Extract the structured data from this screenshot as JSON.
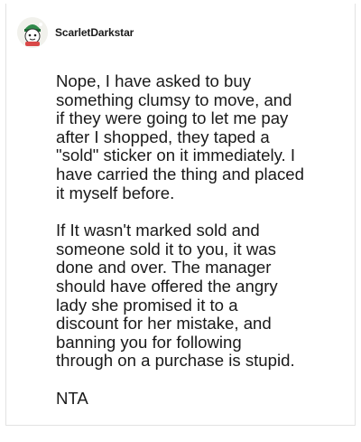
{
  "comment": {
    "username": "ScarletDarkstar",
    "avatar_icon": "avatar-icon",
    "paragraphs": [
      "Nope, I have asked to buy\nsomething clumsy to move, and\nif they were going to let me pay\nafter I shopped, they taped a\n\"sold\" sticker on it immediately. I\nhave carried the thing and placed\nit myself before.",
      "If It wasn't marked sold and\nsomeone sold it to you, it was\ndone and over. The manager\nshould have offered the angry\nlady she promised it to a\ndiscount for her mistake, and\nbanning you for following\nthrough on a purchase is stupid.",
      "NTA"
    ]
  }
}
